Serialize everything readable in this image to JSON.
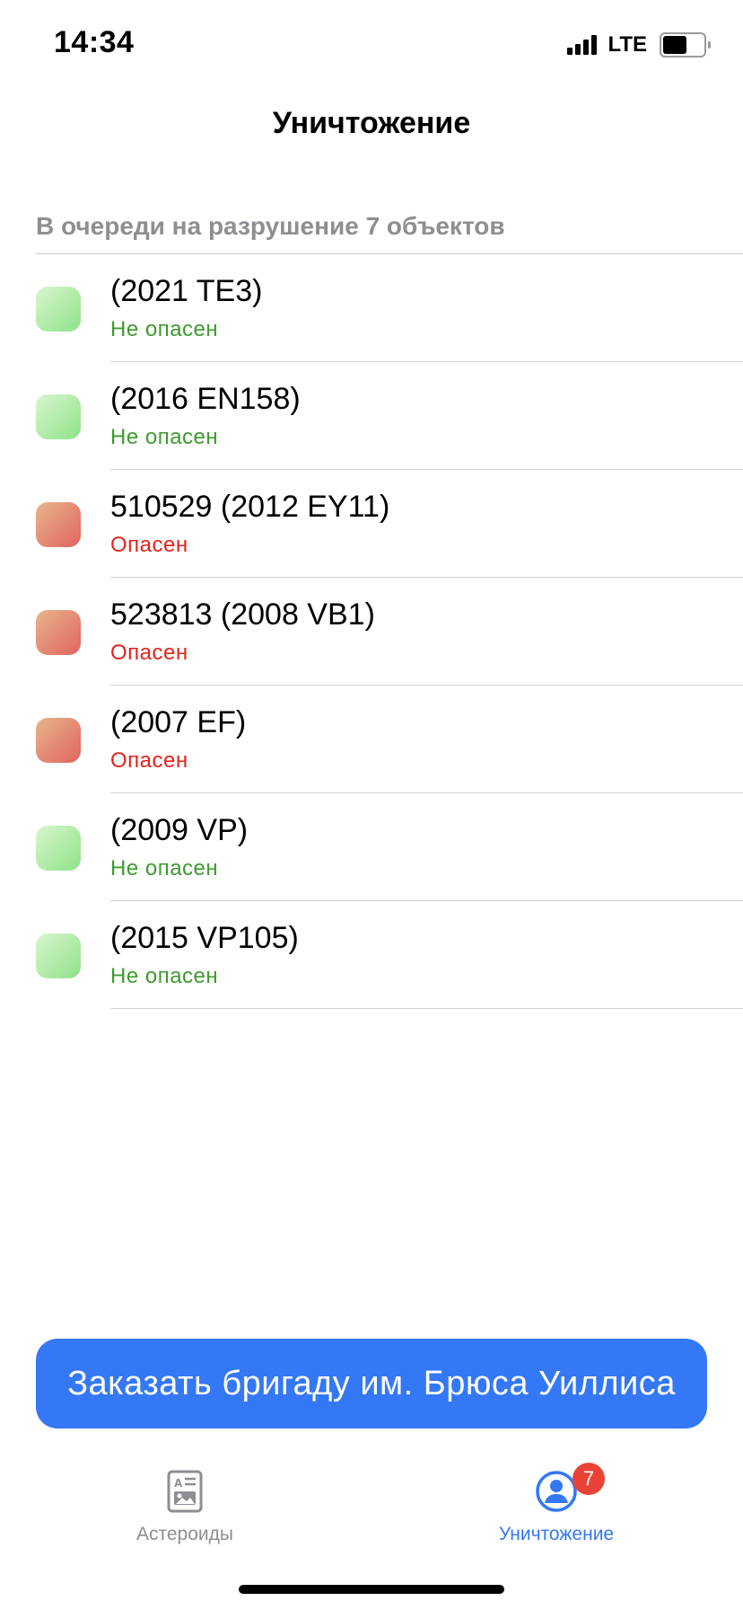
{
  "status_bar": {
    "time": "14:34",
    "network": "LTE",
    "signal_icon": "signal-bars-icon",
    "battery_icon": "battery-icon"
  },
  "nav": {
    "title": "Уничтожение"
  },
  "section": {
    "header": "В очереди на разрушение 7 объектов"
  },
  "items": [
    {
      "name": "(2021 TE3)",
      "status": "Не опасен",
      "hazard": "safe"
    },
    {
      "name": "(2016 EN158)",
      "status": "Не опасен",
      "hazard": "safe"
    },
    {
      "name": "510529 (2012 EY11)",
      "status": "Опасен",
      "hazard": "danger"
    },
    {
      "name": "523813 (2008 VB1)",
      "status": "Опасен",
      "hazard": "danger"
    },
    {
      "name": "(2007 EF)",
      "status": "Опасен",
      "hazard": "danger"
    },
    {
      "name": "(2009 VP)",
      "status": "Не опасен",
      "hazard": "safe"
    },
    {
      "name": "(2015 VP105)",
      "status": "Не опасен",
      "hazard": "safe"
    }
  ],
  "order_button": {
    "label": "Заказать бригаду им. Брюса Уиллиса"
  },
  "tab_bar": {
    "tabs": [
      {
        "label": "Астероиды",
        "icon": "asteroid-list-icon",
        "selected": false
      },
      {
        "label": "Уничтожение",
        "icon": "person-circle-icon",
        "selected": true,
        "badge": "7"
      }
    ]
  },
  "colors": {
    "accent": "#3478f6",
    "safe_text": "#3e9b2f",
    "danger_text": "#e3231b",
    "badge": "#ea4335",
    "secondary_text": "#8e8e93"
  }
}
